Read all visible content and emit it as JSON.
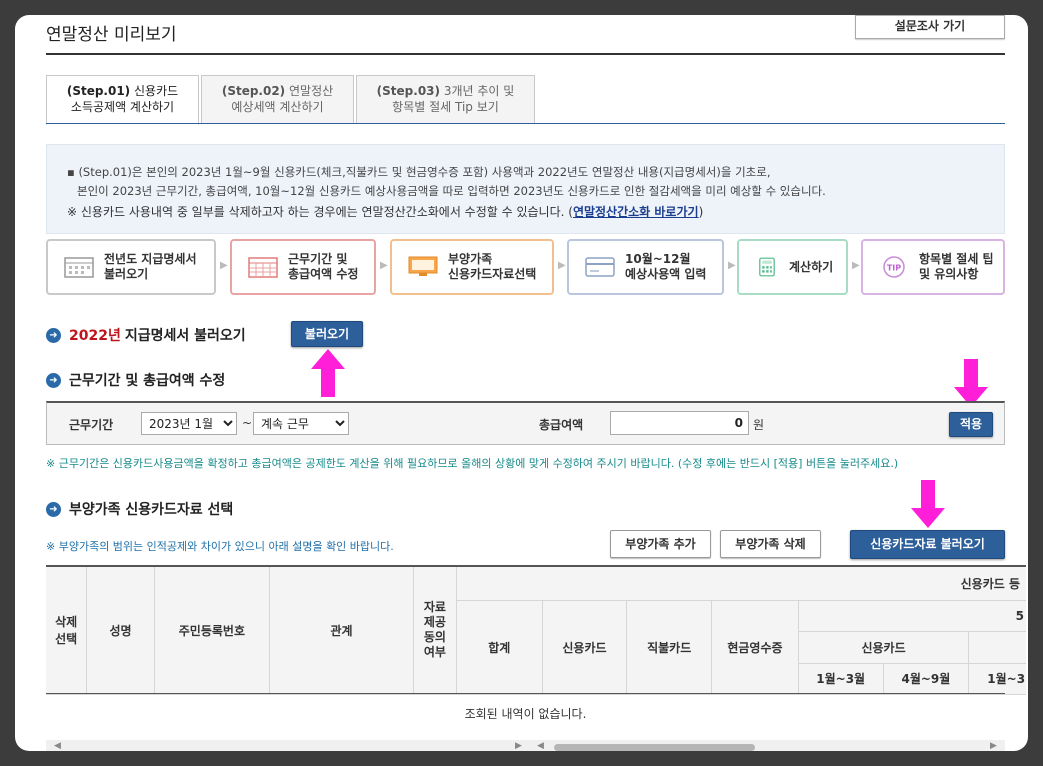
{
  "page": {
    "title": "연말정산 미리보기",
    "survey_button": "설문조사 가기"
  },
  "tabs": [
    {
      "step": "(Step.01)",
      "line1": "신용카드",
      "line2": "소득공제액 계산하기",
      "active": true
    },
    {
      "step": "(Step.02)",
      "line1": "연말정산",
      "line2": "예상세액 계산하기",
      "active": false
    },
    {
      "step": "(Step.03)",
      "line1": "3개년 추이 및",
      "line2": "항목별 절세 Tip 보기",
      "active": false
    }
  ],
  "info": {
    "line1": "▪ (Step.01)은 본인의 2023년 1월~9월 신용카드(체크,직불카드 및 현금영수증 포함) 사용액과 2022년도 연말정산 내용(지급명세서)을 기초로,",
    "line2": "본인이 2023년 근무기간, 총급여액, 10월~12월 신용카드 예상사용금액을 따로 입력하면 2023년도 신용카드로 인한 절감세액을 미리 예상할 수 있습니다.",
    "note_prefix": "※ 신용카드 사용내역 중 일부를 삭제하고자 하는 경우에는 연말정산간소화에서 수정할 수 있습니다. (",
    "note_link": "연말정산간소화 바로가기",
    "note_suffix": ")"
  },
  "steps": [
    {
      "line1": "전년도 지급명세서",
      "line2": "불러오기",
      "color": "#c9c9c9",
      "icon": "calendar-icon"
    },
    {
      "line1": "근무기간 및",
      "line2": "총급여액 수정",
      "color": "#e8a3a3",
      "icon": "calendar-grid-icon"
    },
    {
      "line1": "부양가족",
      "line2": "신용카드자료선택",
      "color": "#f2c08f",
      "icon": "monitor-icon"
    },
    {
      "line1": "10월~12월",
      "line2": "예상사용액 입력",
      "color": "#b9c6dd",
      "icon": "card-icon"
    },
    {
      "line1": "계산하기",
      "line2": "",
      "color": "#a8dcc4",
      "icon": "calculator-icon"
    },
    {
      "line1": "항목별 절세 팁",
      "line2": "및 유의사항",
      "color": "#d8b3e3",
      "icon": "tip-icon"
    }
  ],
  "section1": {
    "year": "2022년",
    "title": "지급명세서 불러오기",
    "button": "불러오기"
  },
  "section2": {
    "title": "근무기간 및 총급여액 수정",
    "period_label": "근무기간",
    "period_start": "2023년 1월",
    "tilde": "~",
    "period_end": "계속 근무",
    "salary_label": "총급여액",
    "salary_value": "0",
    "unit": "원",
    "apply_button": "적용",
    "note": "※ 근무기간은 신용카드사용금액을 확정하고 총급여액은 공제한도 계산을 위해 필요하므로 올해의 상황에 맞게 수정하여 주시기 바랍니다. (수정 후에는 반드시 [적용] 버튼을 눌러주세요.)"
  },
  "section3": {
    "title": "부양가족 신용카드자료 선택",
    "note": "※ 부양가족의 범위는 인적공제와 차이가 있으니 아래 설명을 확인 바랍니다.",
    "add_button": "부양가족 추가",
    "delete_button": "부양가족 삭제",
    "load_button": "신용카드자료 불러오기"
  },
  "table": {
    "headers": {
      "select": [
        "삭제",
        "선택"
      ],
      "name": "성명",
      "rrn": "주민등록번호",
      "relation": "관계",
      "consent": [
        "자료",
        "제공",
        "동의",
        "여부"
      ],
      "group_top": "신용카드 등",
      "total": "합계",
      "credit": "신용카드",
      "debit": "직불카드",
      "cash": "현금영수증",
      "sub_group": "5",
      "sub_credit": "신용카드",
      "m13": "1월~3월",
      "m49": "4월~9월",
      "m13b": "1월~3"
    },
    "empty_message": "조회된 내역이 없습니다."
  },
  "colors": {
    "accent": "#2d5f9a",
    "highlight_arrow": "#ff1fd8",
    "red_year": "#c0141c",
    "note_green": "#168a8a"
  }
}
